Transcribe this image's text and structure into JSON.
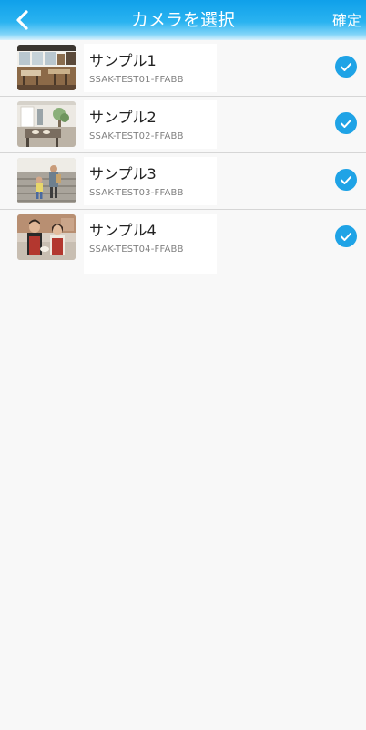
{
  "header": {
    "title": "カメラを選択",
    "confirm_label": "確定"
  },
  "cameras": [
    {
      "name": "サンプル1",
      "id": "SSAK-TEST01-FFABB",
      "selected": true,
      "thumbnail_icon": "cafe-interior-thumbnail"
    },
    {
      "name": "サンプル2",
      "id": "SSAK-TEST02-FFABB",
      "selected": true,
      "thumbnail_icon": "shop-counter-thumbnail"
    },
    {
      "name": "サンプル3",
      "id": "SSAK-TEST03-FFABB",
      "selected": true,
      "thumbnail_icon": "stairs-family-thumbnail"
    },
    {
      "name": "サンプル4",
      "id": "SSAK-TEST04-FFABB",
      "selected": true,
      "thumbnail_icon": "shop-staff-thumbnail"
    }
  ],
  "colors": {
    "header_blue": "#1fa3e6",
    "check_blue": "#1fa3e6",
    "background": "#f8f8f8"
  }
}
